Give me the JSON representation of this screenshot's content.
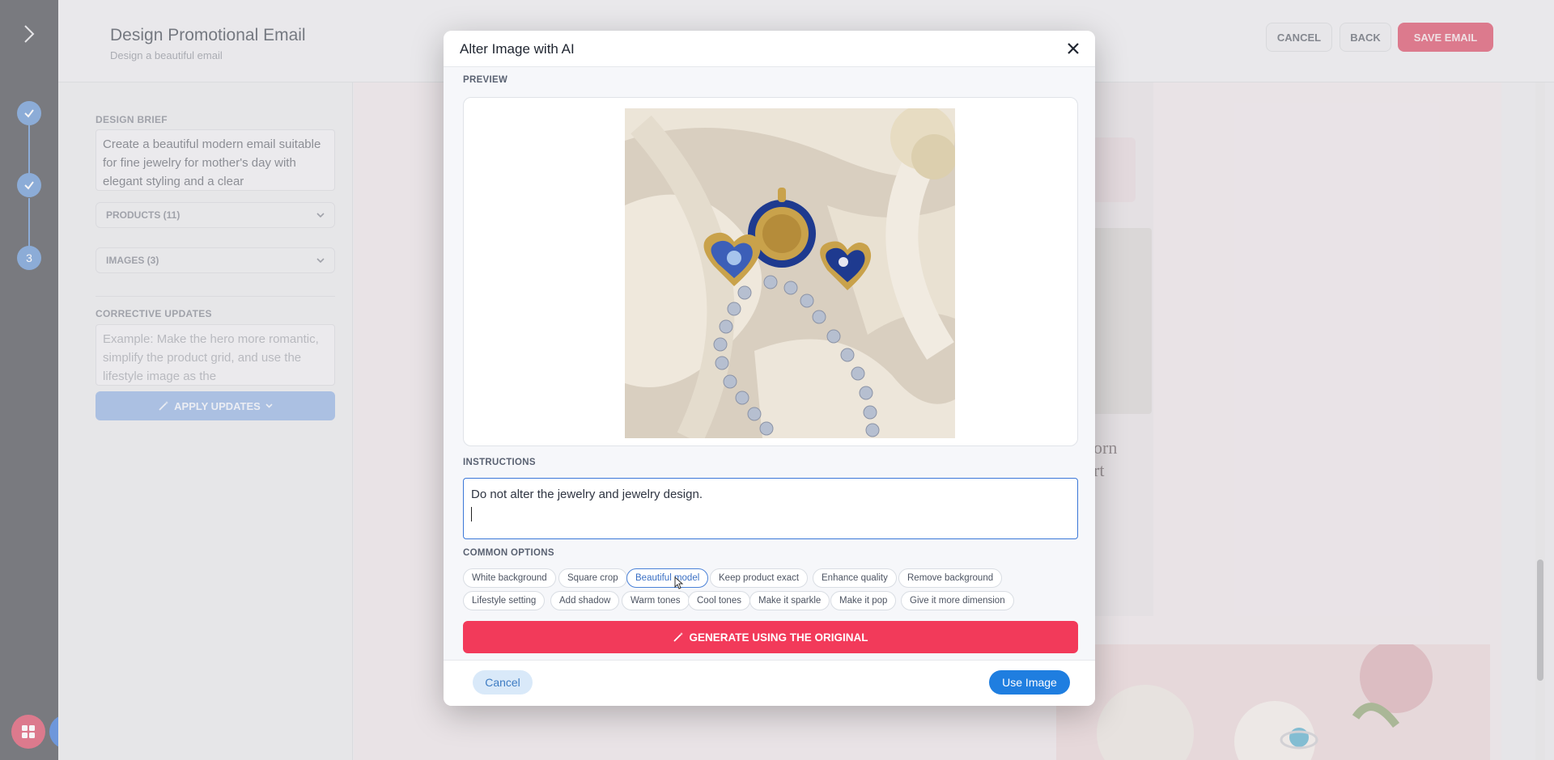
{
  "header": {
    "title": "Design Promotional Email",
    "subtitle": "Design a beautiful email",
    "cancel_label": "CANCEL",
    "back_label": "BACK",
    "save_label": "SAVE EMAIL"
  },
  "steps": {
    "current": "3"
  },
  "sidebar": {
    "design_brief_label": "DESIGN BRIEF",
    "design_brief_text": "Create a beautiful modern email suitable for fine jewelry for mother's day with elegant styling and a clear",
    "products_label": "PRODUCTS (11)",
    "images_label": "IMAGES (3)",
    "corrective_label": "CORRECTIVE UPDATES",
    "corrective_placeholder": "Example: Make the hero more romantic, simplify the product grid, and use the lifestyle image as the",
    "apply_label": "APPLY UPDATES"
  },
  "email_preview": {
    "partial_text_1": "orn",
    "partial_text_2": "rt"
  },
  "modal": {
    "title": "Alter Image with AI",
    "preview_label": "PREVIEW",
    "instructions_label": "INSTRUCTIONS",
    "instructions_value": "Do not alter the jewelry and jewelry design.",
    "common_options_label": "COMMON OPTIONS",
    "options_row1": [
      "White background",
      "Square crop",
      "Beautiful model",
      "Keep product exact",
      "Enhance quality",
      "Remove background"
    ],
    "options_row2": [
      "Lifestyle setting",
      "Add shadow",
      "Warm tones",
      "Cool tones",
      "Make it sparkle",
      "Make it pop",
      "Give it more dimension"
    ],
    "active_option": "Beautiful model",
    "generate_label": "GENERATE USING THE ORIGINAL",
    "cancel_label": "Cancel",
    "use_label": "Use Image"
  },
  "colors": {
    "accent_blue": "#1f7ee0",
    "generate_red": "#f23a5a",
    "save_red": "#d8435f",
    "rail": "#3f4349"
  }
}
